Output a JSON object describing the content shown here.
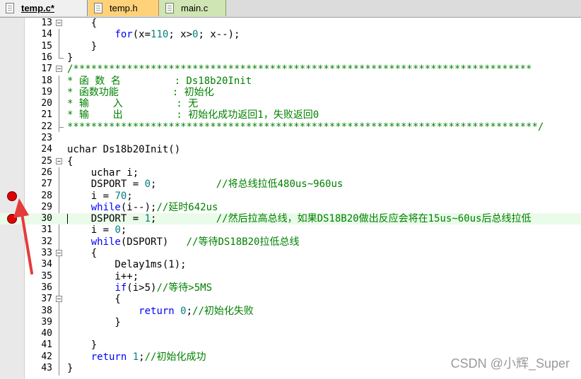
{
  "tabs": [
    {
      "label": "temp.c*",
      "active": true,
      "color": "#f0f0f0"
    },
    {
      "label": "temp.h",
      "active": false,
      "color": "#ffd27a"
    },
    {
      "label": "main.c",
      "active": false,
      "color": "#cfe5b4"
    }
  ],
  "breakpoint_color": "#e00000",
  "annotation_arrow_color": "#e63b3b",
  "lines": [
    {
      "num": "13",
      "text": "    {"
    },
    {
      "num": "14",
      "kw1": "for",
      "rest1": "(x=",
      "n1": "110",
      "rest2": "; x>",
      "n2": "0",
      "rest3": "; x--);"
    },
    {
      "num": "15",
      "text": "    }"
    },
    {
      "num": "16",
      "text": "}"
    },
    {
      "num": "17",
      "text": "/*****************************************************************************"
    },
    {
      "num": "18",
      "text": "* 函 数 名         : Ds18b20Init"
    },
    {
      "num": "19",
      "text": "* 函数功能         : 初始化"
    },
    {
      "num": "20",
      "text": "* 输    入         : 无"
    },
    {
      "num": "21",
      "text": "* 输    出         : 初始化成功返回1，失败返回0"
    },
    {
      "num": "22",
      "text": "*******************************************************************************/"
    },
    {
      "num": "23",
      "text": ""
    },
    {
      "num": "24",
      "text": "uchar Ds18b20Init()"
    },
    {
      "num": "25",
      "text": "{"
    },
    {
      "num": "26",
      "text": "    uchar i;"
    },
    {
      "num": "27",
      "pre": "    DSPORT = ",
      "n": "0",
      "mid": ";          ",
      "cm": "//将总线拉低480us~960us"
    },
    {
      "num": "28",
      "pre": "    i = ",
      "n": "70",
      "mid": ";",
      "cm": ""
    },
    {
      "num": "29",
      "kw": "while",
      "mid": "(i--);",
      "cm": "//延时642us"
    },
    {
      "num": "30",
      "pre": "    DSPORT = ",
      "n": "1",
      "mid": ";          ",
      "cm": "//然后拉高总线，如果DS18B20做出反应会将在15us~60us后总线拉低"
    },
    {
      "num": "31",
      "pre": "    i = ",
      "n": "0",
      "mid": ";",
      "cm": ""
    },
    {
      "num": "32",
      "kw": "while",
      "mid": "(DSPORT)   ",
      "cm": "//等待DS18B20拉低总线"
    },
    {
      "num": "33",
      "text": "    {"
    },
    {
      "num": "34",
      "text": "        Delay1ms(1);"
    },
    {
      "num": "35",
      "text": "        i++;"
    },
    {
      "num": "36",
      "kw": "if",
      "mid": "(i>5)",
      "cm": "//等待>5MS"
    },
    {
      "num": "37",
      "text": "        {"
    },
    {
      "num": "38",
      "kw": "return",
      "n": "0",
      "mid": ";",
      "cm": "//初始化失败"
    },
    {
      "num": "39",
      "text": "        }"
    },
    {
      "num": "40",
      "text": ""
    },
    {
      "num": "41",
      "text": "    }"
    },
    {
      "num": "42",
      "kw": "return",
      "n": "1",
      "mid": ";",
      "cm": "//初始化成功"
    },
    {
      "num": "43",
      "text": "}"
    }
  ],
  "watermark": "CSDN @小辉_Super"
}
